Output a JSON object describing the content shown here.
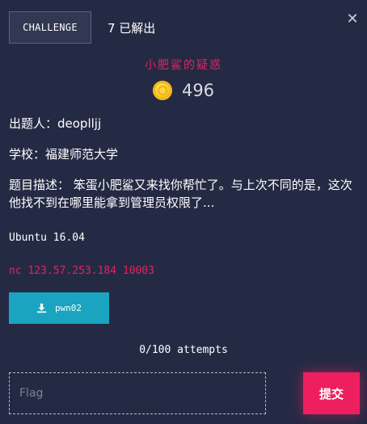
{
  "header": {
    "tab_label": "CHALLENGE",
    "solves": "7 已解出",
    "close_icon": "close-icon"
  },
  "challenge": {
    "title": "小肥鲨的疑惑",
    "points": "496",
    "author": "出题人：deoplljj",
    "school": "学校：福建师范大学",
    "description": "题目描述： 笨蛋小肥鲨又来找你帮忙了。与上次不同的是，这次他找不到在哪里能拿到管理员权限了...",
    "os": "Ubuntu 16.04",
    "connection": "nc 123.57.253.184 10003",
    "file_label": "pwn02",
    "attempts": "0/100 attempts"
  },
  "form": {
    "flag_placeholder": "Flag",
    "submit_label": "提交"
  },
  "colors": {
    "background": "#252a44",
    "accent_pink": "#e0245e",
    "download_button": "#1aa4bf",
    "submit_button": "#ee1f5f",
    "coin": "#f7c325"
  },
  "icons": {
    "coin": "coin-icon",
    "download": "download-icon"
  }
}
